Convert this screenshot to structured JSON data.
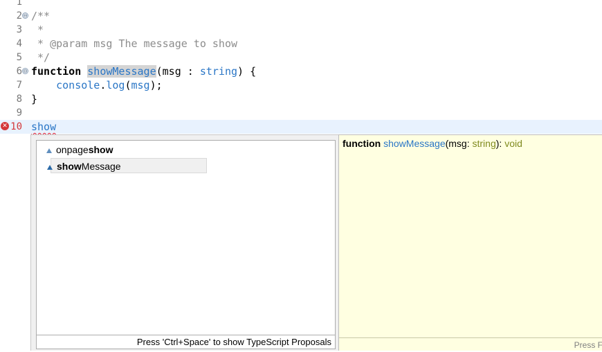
{
  "editor": {
    "line_numbers": [
      "1",
      "2",
      "3",
      "4",
      "5",
      "6",
      "7",
      "8",
      "9",
      "10"
    ],
    "line2": "/**",
    "line3": " *",
    "line4": " * @param msg The message to show",
    "line5": " */",
    "line6": {
      "keyword": "function",
      "name": "showMessage",
      "params_open": "(msg : ",
      "type": "string",
      "params_close": ") {"
    },
    "line7": {
      "indent": "    ",
      "obj": "console",
      "dot": ".",
      "method": "log",
      "paren_open": "(",
      "arg": "msg",
      "paren_close": ");"
    },
    "line8": "}",
    "line10": "show",
    "fold_glyph": "⊖",
    "error_glyph": "✕"
  },
  "completion": {
    "items": [
      {
        "prefix": "onpage",
        "match": "show",
        "icon": "triangle-outline-icon"
      },
      {
        "match": "show",
        "suffix": "Message",
        "icon": "triangle-filled-icon"
      }
    ],
    "status": "Press 'Ctrl+Space' to show TypeScript Proposals"
  },
  "info": {
    "keyword": "function",
    "name": "showMessage",
    "params_open": "(msg: ",
    "param_type": "string",
    "params_close": "): ",
    "return_type": "void",
    "footer": "Press F"
  },
  "colors": {
    "accent": "#2a76c6",
    "current_line": "#e8f2fe",
    "info_background": "#ffffe1",
    "error": "#d4373a"
  }
}
